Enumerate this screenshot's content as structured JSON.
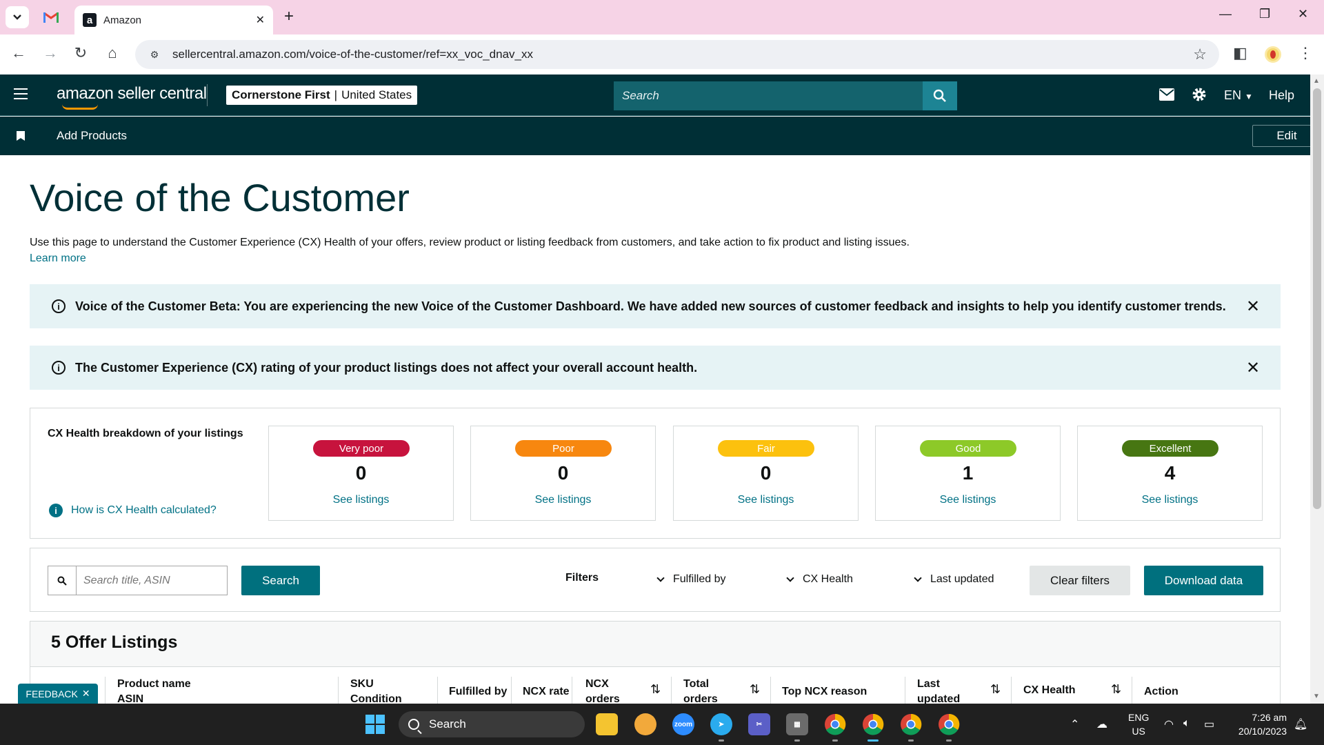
{
  "browser": {
    "active_tab_title": "Amazon",
    "url": "sellercentral.amazon.com/voice-of-the-customer/ref=xx_voc_dnav_xx"
  },
  "header": {
    "brand": "amazon seller central",
    "account_name": "Cornerstone First",
    "account_region": "United States",
    "search_placeholder": "Search",
    "language": "EN",
    "help_label": "Help"
  },
  "bookmarks": {
    "items": [
      {
        "label": "Add Products"
      }
    ],
    "edit_label": "Edit"
  },
  "page": {
    "title": "Voice of the Customer",
    "intro": "Use this page to understand the Customer Experience (CX) Health of your offers, review product or listing feedback from customers, and take action to fix product and listing issues.",
    "learn_more": "Learn more"
  },
  "alerts": [
    {
      "text": "Voice of the Customer Beta: You are experiencing the new Voice of the Customer Dashboard. We have added new sources of customer feedback and insights to help you identify customer trends."
    },
    {
      "text": "The Customer Experience (CX) rating of your product listings does not affect your overall account health."
    }
  ],
  "cx_health": {
    "heading": "CX Health breakdown of your listings",
    "help_link": "How is CX Health calculated?",
    "cards": [
      {
        "label": "Very poor",
        "count": "0",
        "link": "See listings",
        "color": "#c7133d"
      },
      {
        "label": "Poor",
        "count": "0",
        "link": "See listings",
        "color": "#f7870f"
      },
      {
        "label": "Fair",
        "count": "0",
        "link": "See listings",
        "color": "#fcc10e"
      },
      {
        "label": "Good",
        "count": "1",
        "link": "See listings",
        "color": "#8dc928"
      },
      {
        "label": "Excellent",
        "count": "4",
        "link": "See listings",
        "color": "#477612"
      }
    ]
  },
  "filters": {
    "search_placeholder": "Search title, ASIN",
    "search_button": "Search",
    "label": "Filters",
    "dropdowns": [
      {
        "label": "Fulfilled by"
      },
      {
        "label": "CX Health"
      },
      {
        "label": "Last updated"
      }
    ],
    "clear_button": "Clear filters",
    "download_button": "Download data"
  },
  "listings": {
    "title": "5 Offer Listings",
    "columns": [
      {
        "line1": "Product name",
        "line2": "ASIN"
      },
      {
        "line1": "SKU",
        "line2": "Condition"
      },
      {
        "line1": "Fulfilled by",
        "line2": ""
      },
      {
        "line1": "NCX rate",
        "line2": ""
      },
      {
        "line1": "NCX",
        "line2": "orders"
      },
      {
        "line1": "Total",
        "line2": "orders"
      },
      {
        "line1": "Top NCX reason",
        "line2": ""
      },
      {
        "line1": "Last",
        "line2": "updated"
      },
      {
        "line1": "CX Health",
        "line2": ""
      },
      {
        "line1": "Action",
        "line2": ""
      }
    ]
  },
  "feedback": {
    "label": "FEEDBACK"
  },
  "taskbar": {
    "search_label": "Search",
    "lang_top": "ENG",
    "lang_bottom": "US",
    "time": "7:26 am",
    "date": "20/10/2023",
    "apps": [
      {
        "name": "file-explorer-icon"
      },
      {
        "name": "paint-icon"
      },
      {
        "name": "zoom-icon"
      },
      {
        "name": "telegram-icon"
      },
      {
        "name": "snipping-tool-icon"
      },
      {
        "name": "calculator-icon"
      },
      {
        "name": "chrome-icon"
      },
      {
        "name": "chrome-icon"
      },
      {
        "name": "chrome-icon"
      },
      {
        "name": "chrome-icon"
      }
    ],
    "zoom_label": "zoom"
  }
}
